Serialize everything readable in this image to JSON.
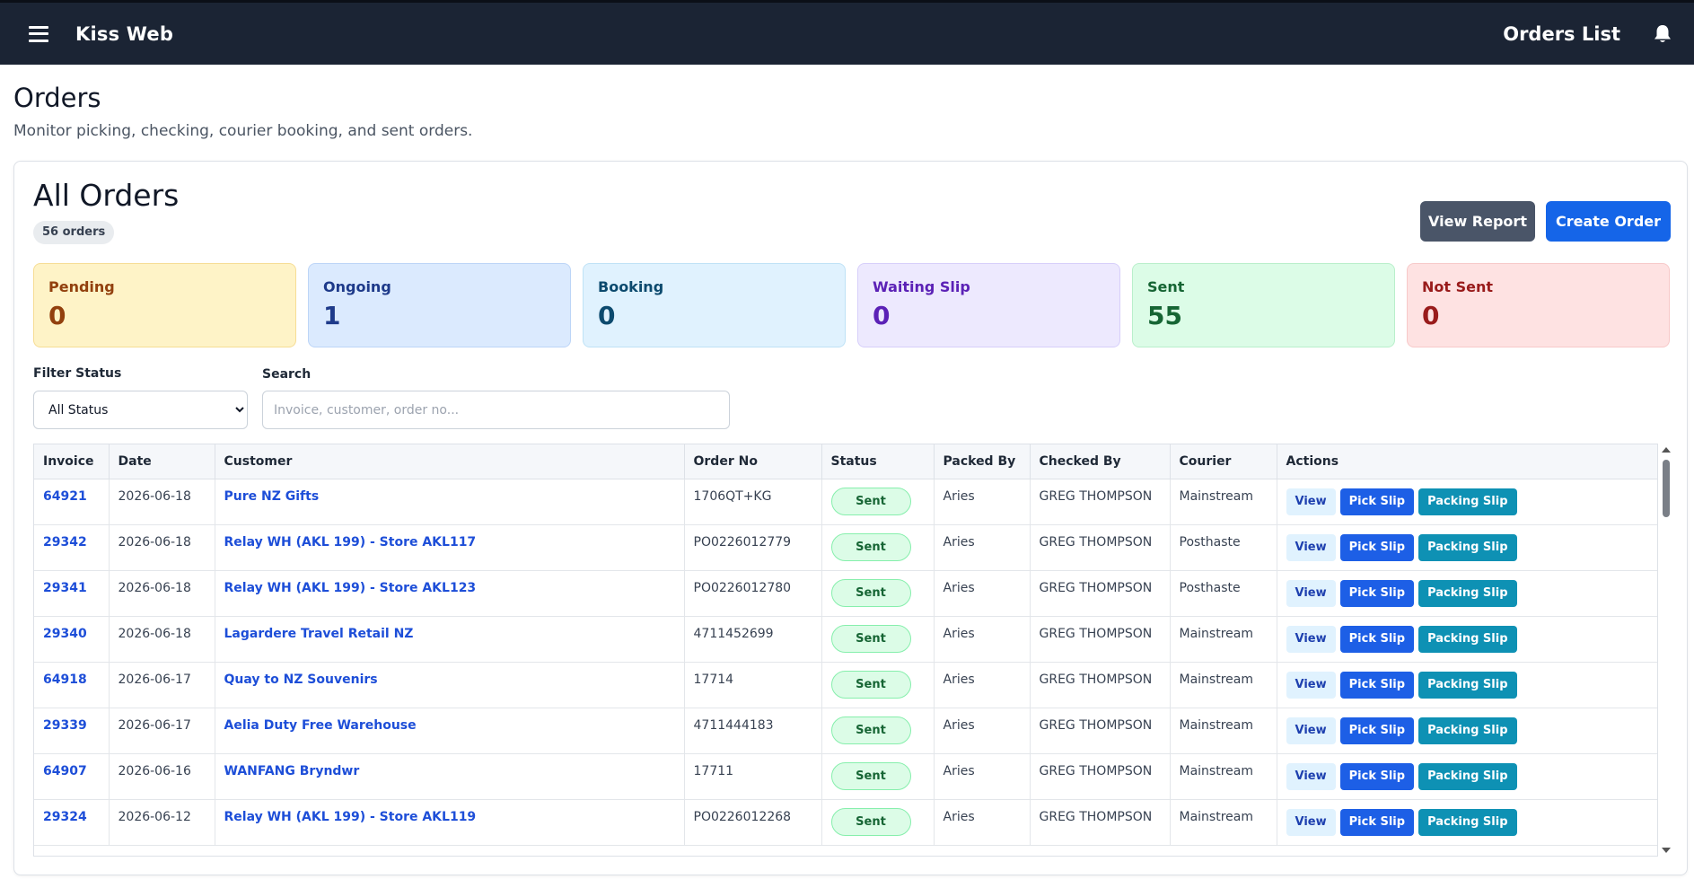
{
  "header": {
    "brand": "Kiss Web",
    "page_title": "Orders List"
  },
  "page": {
    "title": "Orders",
    "subtitle": "Monitor picking, checking, courier booking, and sent orders."
  },
  "card": {
    "title": "All Orders",
    "count_badge": "56 orders",
    "view_report_label": "View Report",
    "create_order_label": "Create Order"
  },
  "stats": [
    {
      "label": "Pending",
      "value": "0"
    },
    {
      "label": "Ongoing",
      "value": "1"
    },
    {
      "label": "Booking",
      "value": "0"
    },
    {
      "label": "Waiting Slip",
      "value": "0"
    },
    {
      "label": "Sent",
      "value": "55"
    },
    {
      "label": "Not Sent",
      "value": "0"
    }
  ],
  "filter": {
    "label": "Filter Status",
    "selected": "All Status"
  },
  "search": {
    "label": "Search",
    "placeholder": "Invoice, customer, order no..."
  },
  "table": {
    "columns": [
      "Invoice",
      "Date",
      "Customer",
      "Order No",
      "Status",
      "Packed By",
      "Checked By",
      "Courier",
      "Actions"
    ],
    "action_labels": {
      "view": "View",
      "pick": "Pick Slip",
      "pack": "Packing Slip"
    },
    "rows": [
      {
        "invoice": "64921",
        "date": "2026-06-18",
        "customer": "Pure NZ Gifts",
        "order_no": "1706QT+KG",
        "status": "Sent",
        "packed_by": "Aries",
        "checked_by": "GREG THOMPSON",
        "courier": "Mainstream"
      },
      {
        "invoice": "29342",
        "date": "2026-06-18",
        "customer": "Relay WH (AKL 199) - Store AKL117",
        "order_no": "PO0226012779",
        "status": "Sent",
        "packed_by": "Aries",
        "checked_by": "GREG THOMPSON",
        "courier": "Posthaste"
      },
      {
        "invoice": "29341",
        "date": "2026-06-18",
        "customer": "Relay WH (AKL 199) - Store AKL123",
        "order_no": "PO0226012780",
        "status": "Sent",
        "packed_by": "Aries",
        "checked_by": "GREG THOMPSON",
        "courier": "Posthaste"
      },
      {
        "invoice": "29340",
        "date": "2026-06-18",
        "customer": "Lagardere Travel Retail NZ",
        "order_no": "4711452699",
        "status": "Sent",
        "packed_by": "Aries",
        "checked_by": "GREG THOMPSON",
        "courier": "Mainstream"
      },
      {
        "invoice": "64918",
        "date": "2026-06-17",
        "customer": "Quay to NZ Souvenirs",
        "order_no": "17714",
        "status": "Sent",
        "packed_by": "Aries",
        "checked_by": "GREG THOMPSON",
        "courier": "Mainstream"
      },
      {
        "invoice": "29339",
        "date": "2026-06-17",
        "customer": "Aelia Duty Free Warehouse",
        "order_no": "4711444183",
        "status": "Sent",
        "packed_by": "Aries",
        "checked_by": "GREG THOMPSON",
        "courier": "Mainstream"
      },
      {
        "invoice": "64907",
        "date": "2026-06-16",
        "customer": "WANFANG Bryndwr",
        "order_no": "17711",
        "status": "Sent",
        "packed_by": "Aries",
        "checked_by": "GREG THOMPSON",
        "courier": "Mainstream"
      },
      {
        "invoice": "29324",
        "date": "2026-06-12",
        "customer": "Relay WH (AKL 199) - Store AKL119",
        "order_no": "PO0226012268",
        "status": "Sent",
        "packed_by": "Aries",
        "checked_by": "GREG THOMPSON",
        "courier": "Mainstream"
      }
    ]
  }
}
